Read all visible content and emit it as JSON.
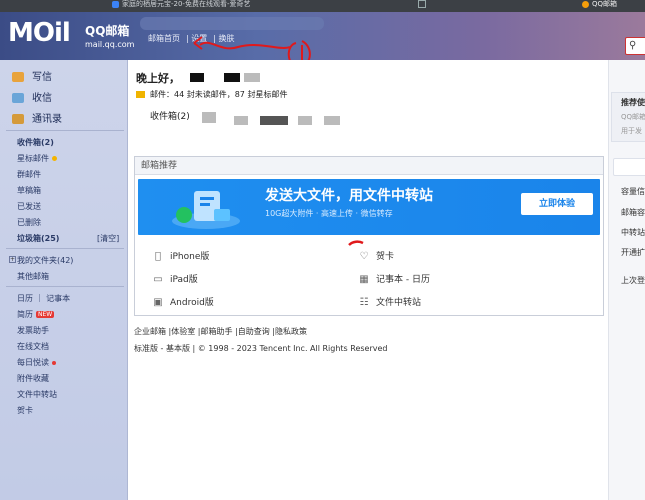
{
  "browser": {
    "tab1_title": "家庭的栖居元宝-20-免费在线观看-爱奇艺",
    "tab2_title": "QQ邮箱"
  },
  "header": {
    "logo_text": "MOil",
    "brand_cn": "QQ邮箱",
    "brand_url": "mail.qq.com",
    "links": [
      "邮箱首页",
      "设置",
      "换肤"
    ],
    "search_icon": "search-icon"
  },
  "sidebar": {
    "compose": [
      "写信",
      "收信",
      "通讯录"
    ],
    "folders": [
      {
        "label": "收件箱(2)",
        "bold": true
      },
      {
        "label": "星标邮件",
        "bold": false
      },
      {
        "label": "群邮件",
        "bold": false
      },
      {
        "label": "草稿箱",
        "bold": false
      },
      {
        "label": "已发送",
        "bold": false
      },
      {
        "label": "已删除",
        "bold": false
      },
      {
        "label": "垃圾箱(25)",
        "bold": true
      }
    ],
    "clear_label": "[清空]",
    "my_folders": "我的文件夹(42)",
    "other_mail": "其他邮箱",
    "calendar": "日历 ｜ 记事本",
    "tools": [
      "简历",
      "发票助手",
      "在线文档",
      "每日悦读",
      "附件收藏",
      "文件中转站",
      "贺卡"
    ],
    "new_badge": "NEW"
  },
  "main": {
    "greeting": "晚上好，",
    "mail_info": "邮件：44 封未读邮件，87 封星标邮件",
    "inbox_label": "收件箱(2)",
    "recommend_title": "邮箱推荐",
    "banner_title": "发送大文件，用文件中转站",
    "banner_sub": "10G超大附件 · 高速上传 · 微信转存",
    "banner_button": "立即体验",
    "apps_left": [
      {
        "label": "iPhone版",
        "icon": "apple-icon"
      },
      {
        "label": "iPad版",
        "icon": "tablet-icon"
      },
      {
        "label": "Android版",
        "icon": "android-icon"
      }
    ],
    "apps_right": [
      {
        "label": "贺卡",
        "icon": "heart-icon"
      },
      {
        "label": "记事本 - 日历",
        "icon": "calendar-icon"
      },
      {
        "label": "文件中转站",
        "icon": "file-transfer-icon"
      }
    ],
    "footer_links": "企业邮箱 |体验室 |邮箱助手 |自助查询 |隐私政策",
    "footer_copy": "标准版 - 基本版 | © 1998 - 2023 Tencent Inc. All Rights Reserved"
  },
  "right": {
    "title": "推荐使",
    "sub1": "QQ邮箱",
    "sub2": "用于发",
    "items": [
      "容量信",
      "邮箱容",
      "中转站",
      "开通扩",
      "上次登"
    ]
  },
  "colors": {
    "header": "#4f5f9e",
    "banner": "#1a84ea",
    "sidebar": "#c8d0e8"
  }
}
